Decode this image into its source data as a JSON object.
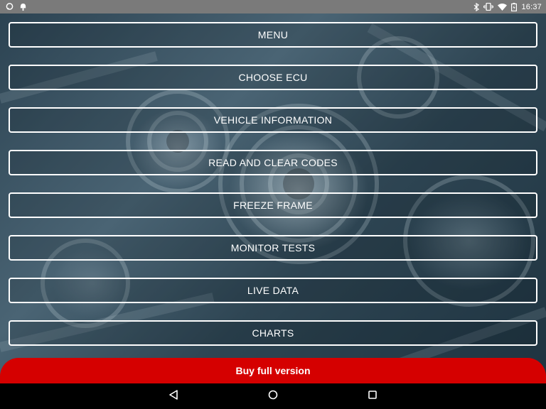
{
  "status_bar": {
    "time": "16:37",
    "left_icons": [
      "chat-notification-icon",
      "android-debug-icon"
    ],
    "right_icons": [
      "bluetooth-icon",
      "vibrate-icon",
      "wifi-icon",
      "battery-icon"
    ]
  },
  "menu": {
    "items": [
      {
        "label": "MENU"
      },
      {
        "label": "CHOOSE ECU"
      },
      {
        "label": "VEHICLE INFORMATION"
      },
      {
        "label": "READ AND CLEAR CODES"
      },
      {
        "label": "FREEZE FRAME"
      },
      {
        "label": "MONITOR TESTS"
      },
      {
        "label": "LIVE DATA"
      },
      {
        "label": "CHARTS"
      }
    ]
  },
  "buy": {
    "label": "Buy full version",
    "color": "#d50000"
  },
  "navigation": {
    "buttons": [
      "back-icon",
      "home-icon",
      "recents-icon"
    ]
  }
}
